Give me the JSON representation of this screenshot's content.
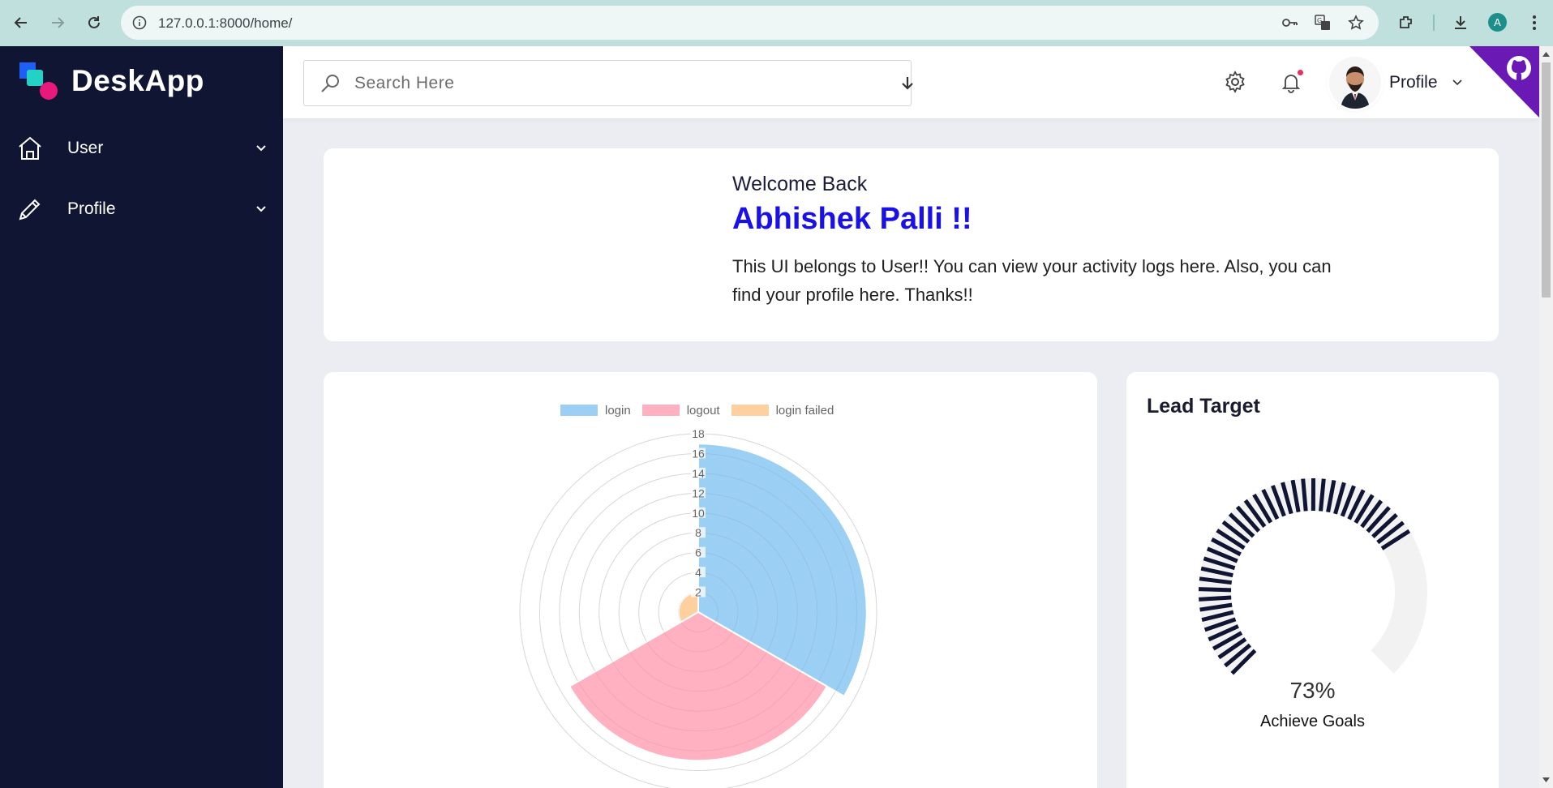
{
  "browser": {
    "url": "127.0.0.1:8000/home/",
    "profile_initial": "A"
  },
  "sidebar": {
    "brand": "DeskApp",
    "items": [
      {
        "label": "User",
        "icon": "home-icon"
      },
      {
        "label": "Profile",
        "icon": "pencil-icon"
      }
    ]
  },
  "header": {
    "search_placeholder": "Search Here",
    "profile_label": "Profile"
  },
  "welcome": {
    "greeting": "Welcome Back",
    "name": "Abhishek Palli !!",
    "message": "This UI belongs to User!! You can view your activity logs here. Also, you can find your profile here. Thanks!!"
  },
  "activity_chart": {
    "legend": [
      {
        "label": "login",
        "color": "#9ccff4"
      },
      {
        "label": "logout",
        "color": "#ffb1c1"
      },
      {
        "label": "login failed",
        "color": "#ffd09f"
      }
    ]
  },
  "chart_data": {
    "type": "polarArea",
    "categories": [
      "login",
      "logout",
      "login failed"
    ],
    "values": [
      17,
      15,
      2
    ],
    "colors": [
      "#9ccff4",
      "#ffb1c1",
      "#ffd09f"
    ],
    "r_ticks": [
      2,
      4,
      6,
      8,
      10,
      12,
      14,
      16,
      18
    ],
    "rlim": [
      0,
      18
    ]
  },
  "lead_target": {
    "title": "Lead Target",
    "percent_value": 73,
    "percent_label": "73%",
    "caption": "Achieve Goals",
    "fill_color": "#0f1532",
    "track_color": "#f2f2f2"
  }
}
